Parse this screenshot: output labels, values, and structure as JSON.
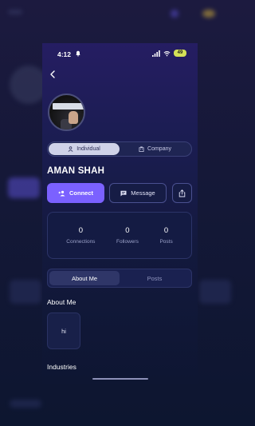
{
  "status_bar": {
    "time": "4:12",
    "battery": "49"
  },
  "account_switch": {
    "individual": "Individual",
    "company": "Company"
  },
  "profile": {
    "name": "AMAN SHAH"
  },
  "actions": {
    "connect": "Connect",
    "message": "Message"
  },
  "stats": [
    {
      "value": "0",
      "label": "Connections"
    },
    {
      "value": "0",
      "label": "Followers"
    },
    {
      "value": "0",
      "label": "Posts"
    }
  ],
  "tabs": {
    "about": "About Me",
    "posts": "Posts"
  },
  "about": {
    "title": "About Me",
    "text": "hi"
  },
  "industries": {
    "title": "Industries"
  },
  "colors": {
    "accent": "#7b61ff",
    "battery": "#d4e157"
  },
  "icons": [
    "bell-icon",
    "signal-icon",
    "wifi-icon",
    "back-arrow-icon",
    "person-icon",
    "building-icon",
    "add-person-icon",
    "message-icon",
    "share-icon"
  ]
}
